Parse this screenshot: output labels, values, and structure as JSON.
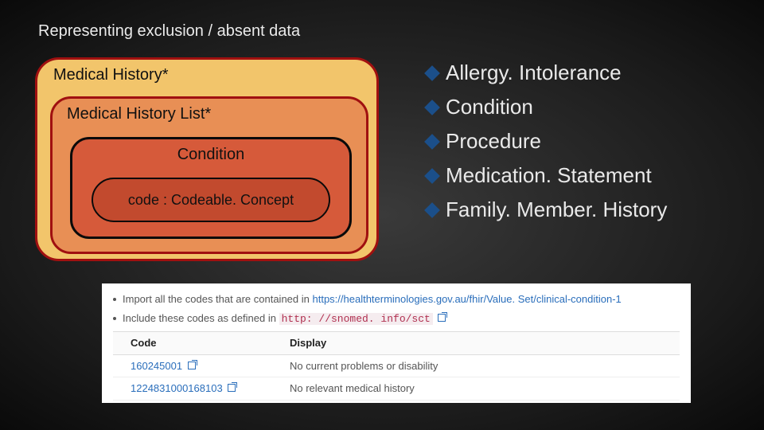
{
  "title": "Representing exclusion / absent data",
  "diagram": {
    "outer": "Medical History*",
    "mid": "Medical History List*",
    "inner": "Condition",
    "pill": "code : Codeable. Concept"
  },
  "bullets": [
    "Allergy. Intolerance",
    "Condition",
    "Procedure",
    "Medication. Statement",
    "Family. Member. History"
  ],
  "codes_panel": {
    "rule1_prefix": "Import all the codes that are contained in ",
    "rule1_url": "https://healthterminologies.gov.au/fhir/Value. Set/clinical-condition-1",
    "rule2_prefix": "Include these codes as defined in ",
    "rule2_code": "http: //snomed. info/sct",
    "th_code": "Code",
    "th_display": "Display",
    "rows": [
      {
        "code": "160245001",
        "display": "No current problems or disability"
      },
      {
        "code": "1224831000168103",
        "display": "No relevant medical history"
      }
    ]
  }
}
